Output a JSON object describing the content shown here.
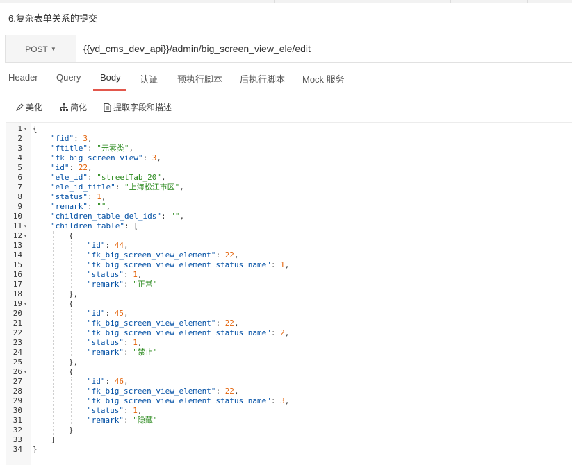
{
  "page": {
    "title": "6.复杂表单关系的提交"
  },
  "request": {
    "method": "POST",
    "url": "{{yd_cms_dev_api}}/admin/big_screen_view_ele/edit"
  },
  "tabs": [
    {
      "label": "Header",
      "active": false
    },
    {
      "label": "Query",
      "active": false
    },
    {
      "label": "Body",
      "active": true
    },
    {
      "label": "认证",
      "active": false
    },
    {
      "label": "预执行脚本",
      "active": false
    },
    {
      "label": "后执行脚本",
      "active": false
    },
    {
      "label": "Mock 服务",
      "active": false
    }
  ],
  "toolbar": [
    {
      "label": "美化",
      "icon": "pencil-icon"
    },
    {
      "label": "简化",
      "icon": "sitemap-icon"
    },
    {
      "label": "提取字段和描述",
      "icon": "document-icon"
    }
  ],
  "editor": {
    "lines": [
      {
        "n": 1,
        "fold": true,
        "indent": 0,
        "tokens": [
          [
            "p",
            "{"
          ]
        ]
      },
      {
        "n": 2,
        "indent": 1,
        "tokens": [
          [
            "k",
            "\"fid\""
          ],
          [
            "p",
            ": "
          ],
          [
            "n",
            "3"
          ],
          [
            "p",
            ","
          ]
        ]
      },
      {
        "n": 3,
        "indent": 1,
        "tokens": [
          [
            "k",
            "\"ftitle\""
          ],
          [
            "p",
            ": "
          ],
          [
            "s",
            "\"元素类\""
          ],
          [
            "p",
            ","
          ]
        ]
      },
      {
        "n": 4,
        "indent": 1,
        "tokens": [
          [
            "k",
            "\"fk_big_screen_view\""
          ],
          [
            "p",
            ": "
          ],
          [
            "n",
            "3"
          ],
          [
            "p",
            ","
          ]
        ]
      },
      {
        "n": 5,
        "indent": 1,
        "tokens": [
          [
            "k",
            "\"id\""
          ],
          [
            "p",
            ": "
          ],
          [
            "n",
            "22"
          ],
          [
            "p",
            ","
          ]
        ]
      },
      {
        "n": 6,
        "indent": 1,
        "tokens": [
          [
            "k",
            "\"ele_id\""
          ],
          [
            "p",
            ": "
          ],
          [
            "s",
            "\"streetTab_20\""
          ],
          [
            "p",
            ","
          ]
        ]
      },
      {
        "n": 7,
        "indent": 1,
        "tokens": [
          [
            "k",
            "\"ele_id_title\""
          ],
          [
            "p",
            ": "
          ],
          [
            "s",
            "\"上海松江市区\""
          ],
          [
            "p",
            ","
          ]
        ]
      },
      {
        "n": 8,
        "indent": 1,
        "tokens": [
          [
            "k",
            "\"status\""
          ],
          [
            "p",
            ": "
          ],
          [
            "n",
            "1"
          ],
          [
            "p",
            ","
          ]
        ]
      },
      {
        "n": 9,
        "indent": 1,
        "tokens": [
          [
            "k",
            "\"remark\""
          ],
          [
            "p",
            ": "
          ],
          [
            "s",
            "\"\""
          ],
          [
            "p",
            ","
          ]
        ]
      },
      {
        "n": 10,
        "indent": 1,
        "tokens": [
          [
            "k",
            "\"children_table_del_ids\""
          ],
          [
            "p",
            ": "
          ],
          [
            "s",
            "\"\""
          ],
          [
            "p",
            ","
          ]
        ]
      },
      {
        "n": 11,
        "fold": true,
        "indent": 1,
        "tokens": [
          [
            "k",
            "\"children_table\""
          ],
          [
            "p",
            ": ["
          ]
        ]
      },
      {
        "n": 12,
        "fold": true,
        "indent": 2,
        "tokens": [
          [
            "p",
            "{"
          ]
        ]
      },
      {
        "n": 13,
        "indent": 3,
        "tokens": [
          [
            "k",
            "\"id\""
          ],
          [
            "p",
            ": "
          ],
          [
            "n",
            "44"
          ],
          [
            "p",
            ","
          ]
        ]
      },
      {
        "n": 14,
        "indent": 3,
        "tokens": [
          [
            "k",
            "\"fk_big_screen_view_element\""
          ],
          [
            "p",
            ": "
          ],
          [
            "n",
            "22"
          ],
          [
            "p",
            ","
          ]
        ]
      },
      {
        "n": 15,
        "indent": 3,
        "tokens": [
          [
            "k",
            "\"fk_big_screen_view_element_status_name\""
          ],
          [
            "p",
            ": "
          ],
          [
            "n",
            "1"
          ],
          [
            "p",
            ","
          ]
        ]
      },
      {
        "n": 16,
        "indent": 3,
        "tokens": [
          [
            "k",
            "\"status\""
          ],
          [
            "p",
            ": "
          ],
          [
            "n",
            "1"
          ],
          [
            "p",
            ","
          ]
        ]
      },
      {
        "n": 17,
        "indent": 3,
        "tokens": [
          [
            "k",
            "\"remark\""
          ],
          [
            "p",
            ": "
          ],
          [
            "s",
            "\"正常\""
          ]
        ]
      },
      {
        "n": 18,
        "indent": 2,
        "tokens": [
          [
            "p",
            "},"
          ]
        ]
      },
      {
        "n": 19,
        "fold": true,
        "indent": 2,
        "tokens": [
          [
            "p",
            "{"
          ]
        ]
      },
      {
        "n": 20,
        "indent": 3,
        "tokens": [
          [
            "k",
            "\"id\""
          ],
          [
            "p",
            ": "
          ],
          [
            "n",
            "45"
          ],
          [
            "p",
            ","
          ]
        ]
      },
      {
        "n": 21,
        "indent": 3,
        "tokens": [
          [
            "k",
            "\"fk_big_screen_view_element\""
          ],
          [
            "p",
            ": "
          ],
          [
            "n",
            "22"
          ],
          [
            "p",
            ","
          ]
        ]
      },
      {
        "n": 22,
        "indent": 3,
        "tokens": [
          [
            "k",
            "\"fk_big_screen_view_element_status_name\""
          ],
          [
            "p",
            ": "
          ],
          [
            "n",
            "2"
          ],
          [
            "p",
            ","
          ]
        ]
      },
      {
        "n": 23,
        "indent": 3,
        "tokens": [
          [
            "k",
            "\"status\""
          ],
          [
            "p",
            ": "
          ],
          [
            "n",
            "1"
          ],
          [
            "p",
            ","
          ]
        ]
      },
      {
        "n": 24,
        "indent": 3,
        "tokens": [
          [
            "k",
            "\"remark\""
          ],
          [
            "p",
            ": "
          ],
          [
            "s",
            "\"禁止\""
          ]
        ]
      },
      {
        "n": 25,
        "indent": 2,
        "tokens": [
          [
            "p",
            "},"
          ]
        ]
      },
      {
        "n": 26,
        "fold": true,
        "indent": 2,
        "tokens": [
          [
            "p",
            "{"
          ]
        ]
      },
      {
        "n": 27,
        "indent": 3,
        "tokens": [
          [
            "k",
            "\"id\""
          ],
          [
            "p",
            ": "
          ],
          [
            "n",
            "46"
          ],
          [
            "p",
            ","
          ]
        ]
      },
      {
        "n": 28,
        "indent": 3,
        "tokens": [
          [
            "k",
            "\"fk_big_screen_view_element\""
          ],
          [
            "p",
            ": "
          ],
          [
            "n",
            "22"
          ],
          [
            "p",
            ","
          ]
        ]
      },
      {
        "n": 29,
        "indent": 3,
        "tokens": [
          [
            "k",
            "\"fk_big_screen_view_element_status_name\""
          ],
          [
            "p",
            ": "
          ],
          [
            "n",
            "3"
          ],
          [
            "p",
            ","
          ]
        ]
      },
      {
        "n": 30,
        "indent": 3,
        "tokens": [
          [
            "k",
            "\"status\""
          ],
          [
            "p",
            ": "
          ],
          [
            "n",
            "1"
          ],
          [
            "p",
            ","
          ]
        ]
      },
      {
        "n": 31,
        "indent": 3,
        "tokens": [
          [
            "k",
            "\"remark\""
          ],
          [
            "p",
            ": "
          ],
          [
            "s",
            "\"隐藏\""
          ]
        ]
      },
      {
        "n": 32,
        "indent": 2,
        "tokens": [
          [
            "p",
            "}"
          ]
        ]
      },
      {
        "n": 33,
        "indent": 1,
        "tokens": [
          [
            "p",
            "]"
          ]
        ]
      },
      {
        "n": 34,
        "indent": 0,
        "tokens": [
          [
            "p",
            "}"
          ]
        ]
      }
    ]
  }
}
